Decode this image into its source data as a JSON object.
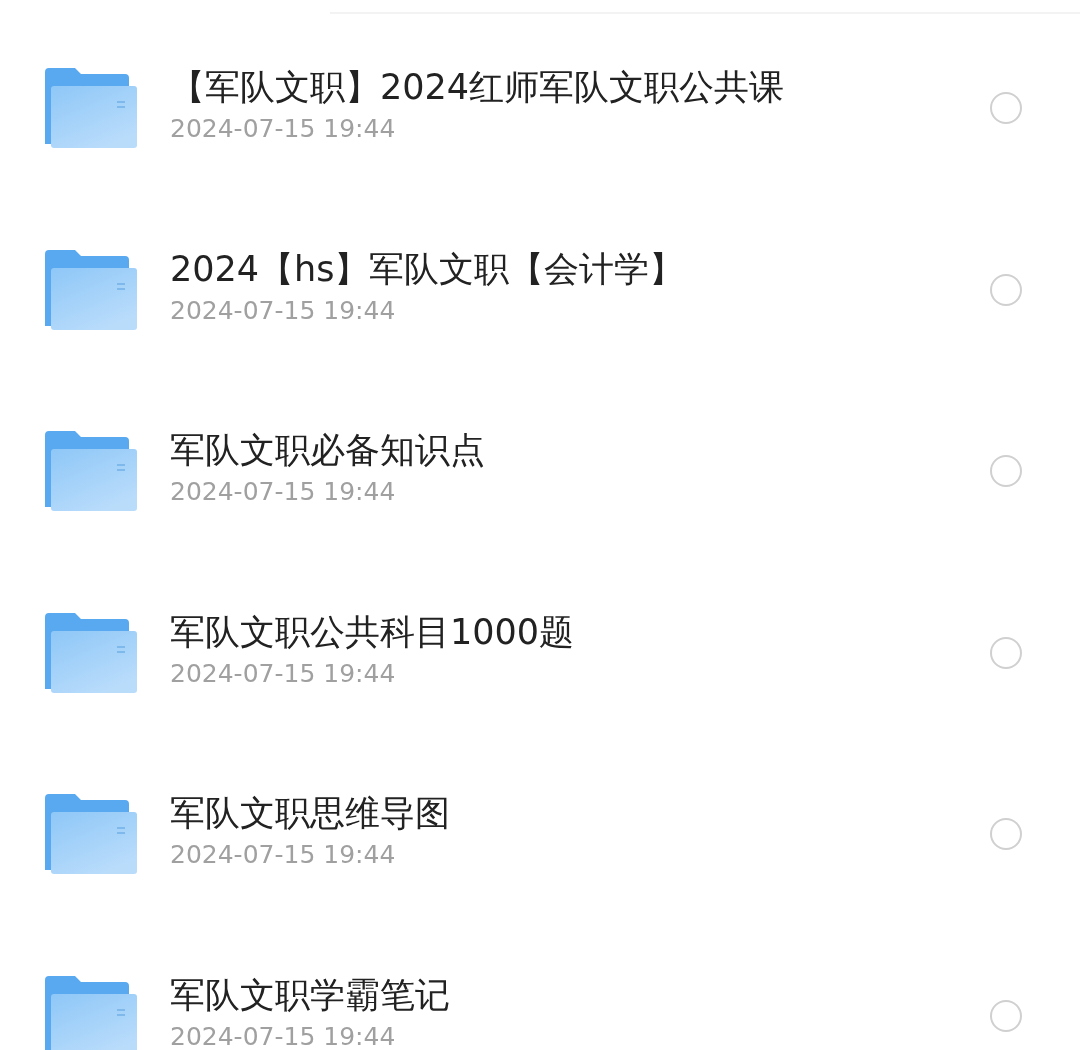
{
  "files": [
    {
      "name": "【军队文职】2024红师军队文职公共课",
      "date": "2024-07-15 19:44",
      "selected": false
    },
    {
      "name": "2024【hs】军队文职【会计学】",
      "date": "2024-07-15 19:44",
      "selected": false
    },
    {
      "name": "军队文职必备知识点",
      "date": "2024-07-15 19:44",
      "selected": false
    },
    {
      "name": "军队文职公共科目1000题",
      "date": "2024-07-15 19:44",
      "selected": false
    },
    {
      "name": "军队文职思维导图",
      "date": "2024-07-15 19:44",
      "selected": false
    },
    {
      "name": "军队文职学霸笔记",
      "date": "2024-07-15 19:44",
      "selected": false
    }
  ]
}
